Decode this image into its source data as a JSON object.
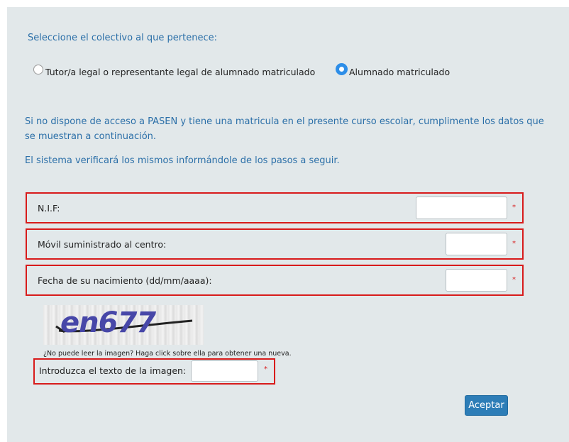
{
  "form": {
    "group_prompt": "Seleccione el colectivo al que pertenece:",
    "radio_options": [
      {
        "label": "Tutor/a legal o representante legal de alumnado matriculado",
        "checked": false
      },
      {
        "label": "Alumnado matriculado",
        "checked": true
      }
    ],
    "info_line1": "Si no dispone de acceso a PASEN y tiene una matricula en el presente curso escolar, cumplimente los datos que",
    "info_line2": "se muestran a continuación.",
    "info_verify": "El sistema verificará los mismos informándole de los pasos a seguir.",
    "fields": [
      {
        "label": "N.I.F:",
        "value": "",
        "required": "*"
      },
      {
        "label": "Móvil suministrado al centro:",
        "value": "",
        "required": "*"
      },
      {
        "label": "Fecha de su nacimiento (dd/mm/aaaa):",
        "value": "",
        "required": "*"
      }
    ],
    "captcha": {
      "image_text": "en677",
      "note": "¿No puede leer la imagen? Haga click sobre ella para obtener una nueva.",
      "label": "Introduzca el texto de la imagen:",
      "value": "",
      "required": "*"
    },
    "submit_label": "Aceptar"
  },
  "colors": {
    "panel_bg": "#e2e8ea",
    "accent_blue": "#2b6fa8",
    "radio_selected": "#2d8ee8",
    "highlight_red": "#d81b1b",
    "button_bg": "#2d7db7"
  }
}
